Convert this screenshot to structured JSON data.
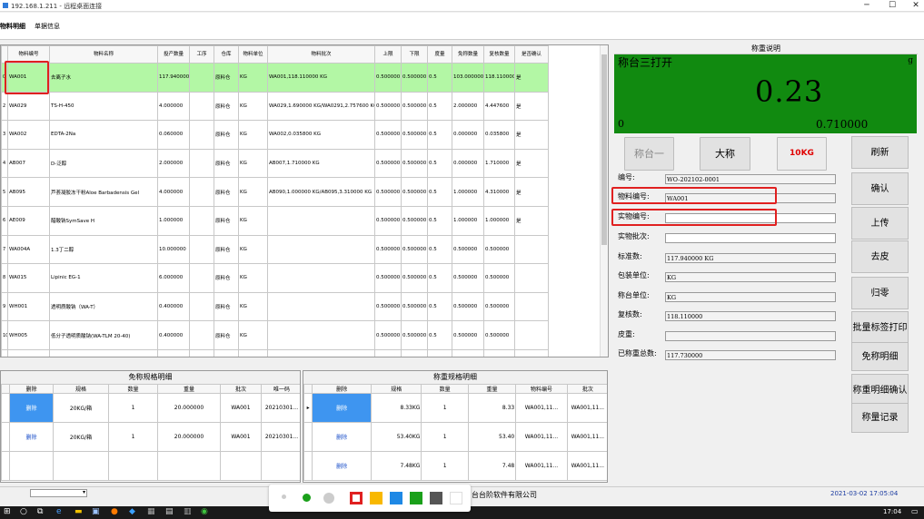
{
  "window": {
    "title": "192.168.1.211 - 远程桌面连接",
    "minimize": "─",
    "maximize": "☐",
    "close": "✕"
  },
  "tabs": [
    {
      "label": "物料明细"
    },
    {
      "label": "单据信息"
    }
  ],
  "main_table": {
    "columns": [
      "物料编号",
      "物料名称",
      "投产数量",
      "工序",
      "仓库",
      "物料单位",
      "物料批次",
      "上限",
      "下限",
      "度量",
      "免称数量",
      "复核数量",
      "是否确认"
    ],
    "rows": [
      {
        "n": "0",
        "code": "WA001",
        "name": "去离子水",
        "qty": "117.940000",
        "proc": "",
        "wh": "原料仓",
        "unit": "KG",
        "batch": "WA001,118.110000 KG",
        "up": "0.500000",
        "low": "0.500000",
        "m": "0.5",
        "free": "103.000000",
        "rev": "118.110000",
        "ok": "是"
      },
      {
        "n": "2",
        "code": "WA029",
        "name": "TS-H-450",
        "qty": "4.000000",
        "proc": "",
        "wh": "原料仓",
        "unit": "KG",
        "batch": "WA029,1.690000 KG/WA0291,2.757600 KG",
        "up": "0.500000",
        "low": "0.500000",
        "m": "0.5",
        "free": "2.000000",
        "rev": "4.447600",
        "ok": "是"
      },
      {
        "n": "3",
        "code": "WA002",
        "name": "EDTA-2Na",
        "qty": "0.060000",
        "proc": "",
        "wh": "原料仓",
        "unit": "KG",
        "batch": "WA002,0.035800 KG",
        "up": "0.500000",
        "low": "0.500000",
        "m": "0.5",
        "free": "0.000000",
        "rev": "0.035800",
        "ok": "是"
      },
      {
        "n": "4",
        "code": "AB007",
        "name": "D-泛醇",
        "qty": "2.000000",
        "proc": "",
        "wh": "原料仓",
        "unit": "KG",
        "batch": "AB007,1.710000 KG",
        "up": "0.500000",
        "low": "0.500000",
        "m": "0.5",
        "free": "0.000000",
        "rev": "1.710000",
        "ok": "是"
      },
      {
        "n": "5",
        "code": "AB095",
        "name": "芦荟凝胶冻干粉Aloe Barbadensis Gel",
        "qty": "4.000000",
        "proc": "",
        "wh": "原料仓",
        "unit": "KG",
        "batch": "AB090,1.000000 KG/AB095,3.310000 KG",
        "up": "0.500000",
        "low": "0.500000",
        "m": "0.5",
        "free": "1.000000",
        "rev": "4.310000",
        "ok": "是"
      },
      {
        "n": "6",
        "code": "AE009",
        "name": "醋酸钠SymSave H",
        "qty": "1.000000",
        "proc": "",
        "wh": "原料仓",
        "unit": "KG",
        "batch": "",
        "up": "0.500000",
        "low": "0.500000",
        "m": "0.5",
        "free": "1.000000",
        "rev": "1.000000",
        "ok": "是"
      },
      {
        "n": "7",
        "code": "WA004A",
        "name": "1.3丁二醇",
        "qty": "10.000000",
        "proc": "",
        "wh": "原料仓",
        "unit": "KG",
        "batch": "",
        "up": "0.500000",
        "low": "0.500000",
        "m": "0.5",
        "free": "0.500000",
        "rev": "0.500000",
        "ok": ""
      },
      {
        "n": "8",
        "code": "WA015",
        "name": "Lipinic EG-1",
        "qty": "6.000000",
        "proc": "",
        "wh": "原料仓",
        "unit": "KG",
        "batch": "",
        "up": "0.500000",
        "low": "0.500000",
        "m": "0.5",
        "free": "0.500000",
        "rev": "0.500000",
        "ok": ""
      },
      {
        "n": "9",
        "code": "WH001",
        "name": "透明质酸钠（WA-T）",
        "qty": "0.400000",
        "proc": "",
        "wh": "原料仓",
        "unit": "KG",
        "batch": "",
        "up": "0.500000",
        "low": "0.500000",
        "m": "0.5",
        "free": "0.500000",
        "rev": "0.500000",
        "ok": ""
      },
      {
        "n": "10",
        "code": "WH005",
        "name": "低分子透明质酸钠(WA-TLM 20-40)",
        "qty": "0.400000",
        "proc": "",
        "wh": "原料仓",
        "unit": "KG",
        "batch": "",
        "up": "0.500000",
        "low": "0.500000",
        "m": "0.5",
        "free": "0.500000",
        "rev": "0.500000",
        "ok": ""
      }
    ]
  },
  "free_table": {
    "title": "免称规格明细",
    "columns": [
      "删除",
      "规格",
      "数量",
      "重量",
      "批次",
      "唯一码"
    ],
    "rows": [
      {
        "del": "删除",
        "spec": "20KG/箱",
        "qty": "1",
        "w": "20.000000",
        "batch": "WA001",
        "uid": "20210301..."
      },
      {
        "del": "删除",
        "spec": "20KG/箱",
        "qty": "1",
        "w": "20.000000",
        "batch": "WA001",
        "uid": "20210301..."
      }
    ]
  },
  "weigh_table": {
    "title": "称重规格明细",
    "columns": [
      "删除",
      "规格",
      "数量",
      "重量",
      "物料编号",
      "批次"
    ],
    "rows": [
      {
        "del": "删除",
        "spec": "8.33KG",
        "qty": "1",
        "w": "8.33",
        "code": "WA001,11...",
        "batch": "WA001,11..."
      },
      {
        "del": "删除",
        "spec": "53.40KG",
        "qty": "1",
        "w": "53.40",
        "code": "WA001,11...",
        "batch": "WA001,11..."
      },
      {
        "del": "删除",
        "spec": "7.48KG",
        "qty": "1",
        "w": "7.48",
        "code": "WA001,11...",
        "batch": "WA001,11..."
      }
    ]
  },
  "panel": {
    "title": "称重说明",
    "scale": {
      "label": "称台三打开",
      "unit": "g",
      "reading": "0.23",
      "zero": "0",
      "tare": "0.710000"
    },
    "scale_buttons": {
      "one": "称台一",
      "big": "大称",
      "kg": "10KG"
    },
    "fields": {
      "doc_no_label": "编号:",
      "doc_no": "WO-202102-0001",
      "mat_code_label": "物料编号:",
      "mat_code": "WA001",
      "obj_code_label": "实物编号:",
      "obj_code": "",
      "obj_batch_label": "实物批次:",
      "obj_batch": "",
      "std_label": "标准数:",
      "std": "117.940000    KG",
      "pack_label": "包装单位:",
      "pack": "KG",
      "scale_unit_label": "称台单位:",
      "scale_unit": "KG",
      "review_label": "复核数:",
      "review": "118.110000",
      "tare_label": "皮重:",
      "tare": "",
      "total_label": "已称重总数:",
      "total": "117.730000"
    },
    "buttons": {
      "refresh": "刷新",
      "confirm": "确认",
      "upload": "上传",
      "tare": "去皮",
      "zero": "归零",
      "batch_print": "批量标签打印",
      "free_detail": "免称明细",
      "weigh_confirm": "称重明细确认",
      "records": "称量记录"
    }
  },
  "status": {
    "company": "台台阶软件有限公司",
    "datetime": "2021-03-02 17:05:04"
  },
  "taskbar": {
    "clock": "17:04"
  },
  "colors": {
    "selected_row": "#b3f7a5",
    "scale_bg": "#118a10",
    "highlight": "#e02020",
    "delete_cell": "#3e95f0"
  }
}
